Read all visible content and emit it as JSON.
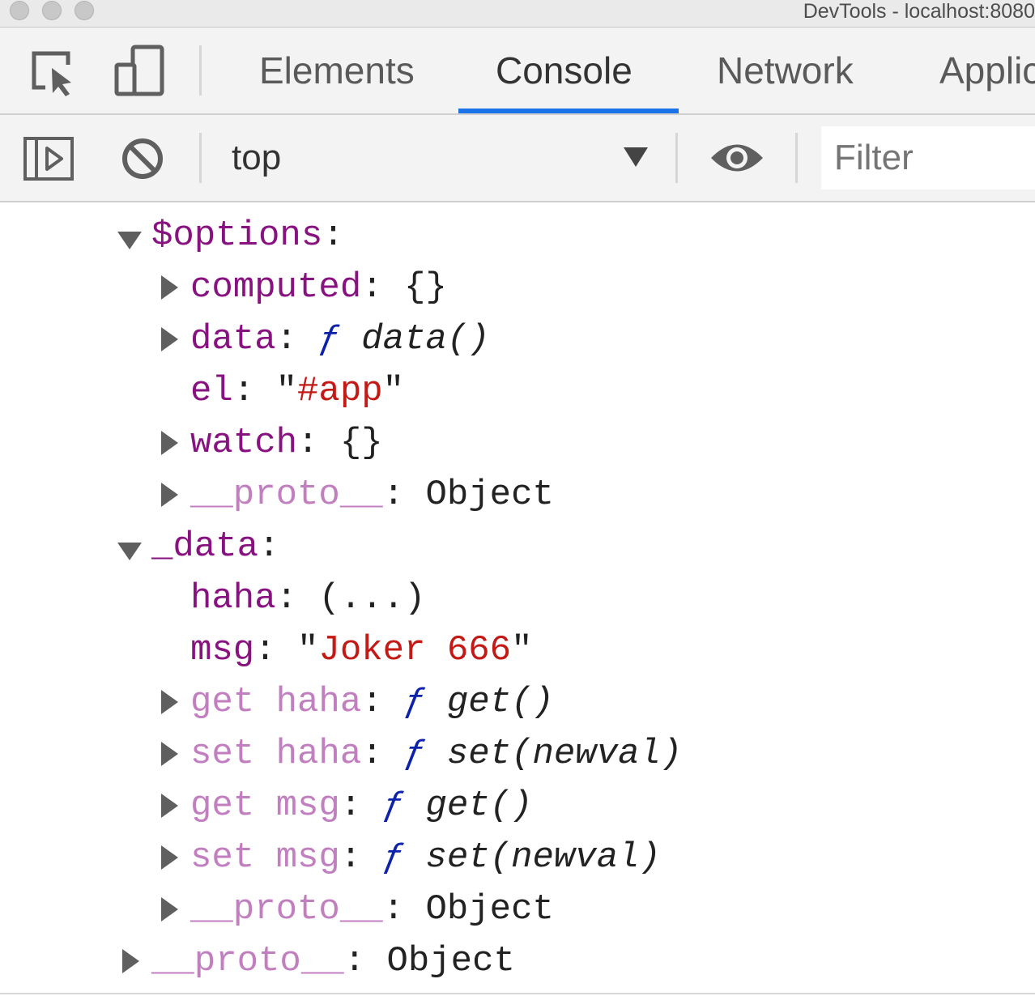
{
  "window": {
    "title": "DevTools - localhost:8080"
  },
  "icons": {
    "inspect": "inspect-element-icon",
    "device": "device-toolbar-icon",
    "sidebar": "sidebar-toggle-icon",
    "clear": "clear-console-icon",
    "dropdown": "chevron-down-icon",
    "eye": "eye-icon",
    "expanded": "triangle-down-icon",
    "collapsed": "triangle-right-icon"
  },
  "tabs": [
    "Elements",
    "Console",
    "Network",
    "Applic"
  ],
  "active_tab": "Console",
  "toolbar": {
    "context": "top",
    "filter_placeholder": "Filter"
  },
  "colors": {
    "accent": "#1a73e8",
    "key": "#881280",
    "key_dim": "#c17fc0",
    "string": "#c41a16",
    "function_keyword": "#0d22aa"
  },
  "tree": {
    "options": {
      "key": "$options",
      "computed": {
        "key": "computed",
        "value": "{}"
      },
      "data": {
        "key": "data",
        "f": "ƒ",
        "sig": "data()"
      },
      "el": {
        "key": "el",
        "value": "#app"
      },
      "watch": {
        "key": "watch",
        "value": "{}"
      },
      "proto": {
        "key": "__proto__",
        "value": "Object"
      }
    },
    "data": {
      "key": "_data",
      "haha": {
        "key": "haha",
        "value": "(...)"
      },
      "msg": {
        "key": "msg",
        "value": "Joker 666"
      },
      "get_haha": {
        "key": "get haha",
        "f": "ƒ",
        "sig": "get()"
      },
      "set_haha": {
        "key": "set haha",
        "f": "ƒ",
        "sig": "set(newval)"
      },
      "get_msg": {
        "key": "get msg",
        "f": "ƒ",
        "sig": "get()"
      },
      "set_msg": {
        "key": "set msg",
        "f": "ƒ",
        "sig": "set(newval)"
      },
      "proto": {
        "key": "__proto__",
        "value": "Object"
      }
    },
    "root_proto": {
      "key": "__proto__",
      "value": "Object"
    }
  }
}
